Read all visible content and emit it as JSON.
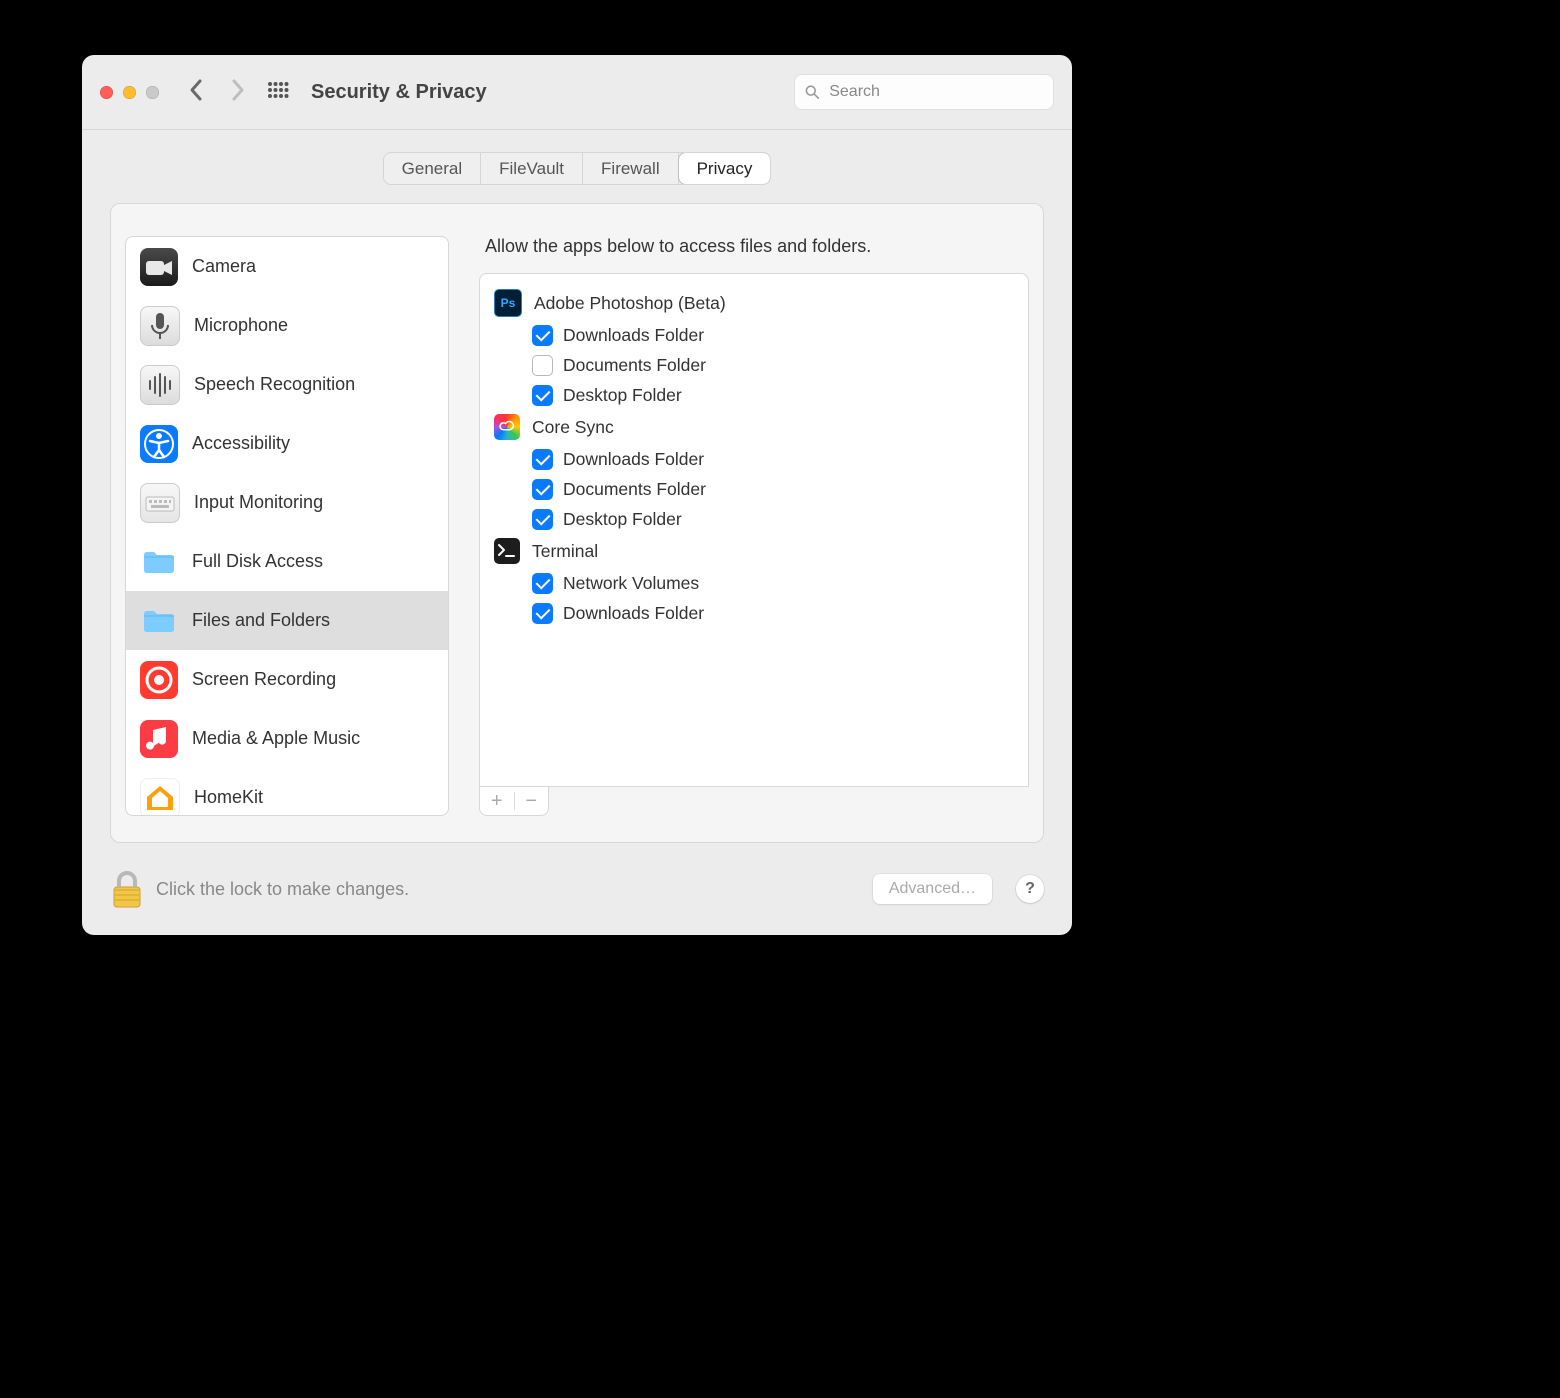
{
  "window": {
    "title": "Security & Privacy"
  },
  "search": {
    "placeholder": "Search"
  },
  "tabs": {
    "items": [
      {
        "label": "General"
      },
      {
        "label": "FileVault"
      },
      {
        "label": "Firewall"
      },
      {
        "label": "Privacy"
      }
    ],
    "active": 3
  },
  "sidebar": {
    "items": [
      {
        "label": "Camera"
      },
      {
        "label": "Microphone"
      },
      {
        "label": "Speech Recognition"
      },
      {
        "label": "Accessibility"
      },
      {
        "label": "Input Monitoring"
      },
      {
        "label": "Full Disk Access"
      },
      {
        "label": "Files and Folders"
      },
      {
        "label": "Screen Recording"
      },
      {
        "label": "Media & Apple Music"
      },
      {
        "label": "HomeKit"
      }
    ],
    "selected": 6
  },
  "detail": {
    "header": "Allow the apps below to access files and folders.",
    "apps": [
      {
        "name": "Adobe Photoshop (Beta)",
        "icon": "photoshop",
        "perms": [
          {
            "label": "Downloads Folder",
            "checked": true
          },
          {
            "label": "Documents Folder",
            "checked": false
          },
          {
            "label": "Desktop Folder",
            "checked": true
          }
        ]
      },
      {
        "name": "Core Sync",
        "icon": "creative-cloud",
        "perms": [
          {
            "label": "Downloads Folder",
            "checked": true
          },
          {
            "label": "Documents Folder",
            "checked": true
          },
          {
            "label": "Desktop Folder",
            "checked": true
          }
        ]
      },
      {
        "name": "Terminal",
        "icon": "terminal",
        "perms": [
          {
            "label": "Network Volumes",
            "checked": true
          },
          {
            "label": "Downloads Folder",
            "checked": true
          }
        ]
      }
    ]
  },
  "footer": {
    "lock_text": "Click the lock to make changes.",
    "advanced": "Advanced…"
  }
}
